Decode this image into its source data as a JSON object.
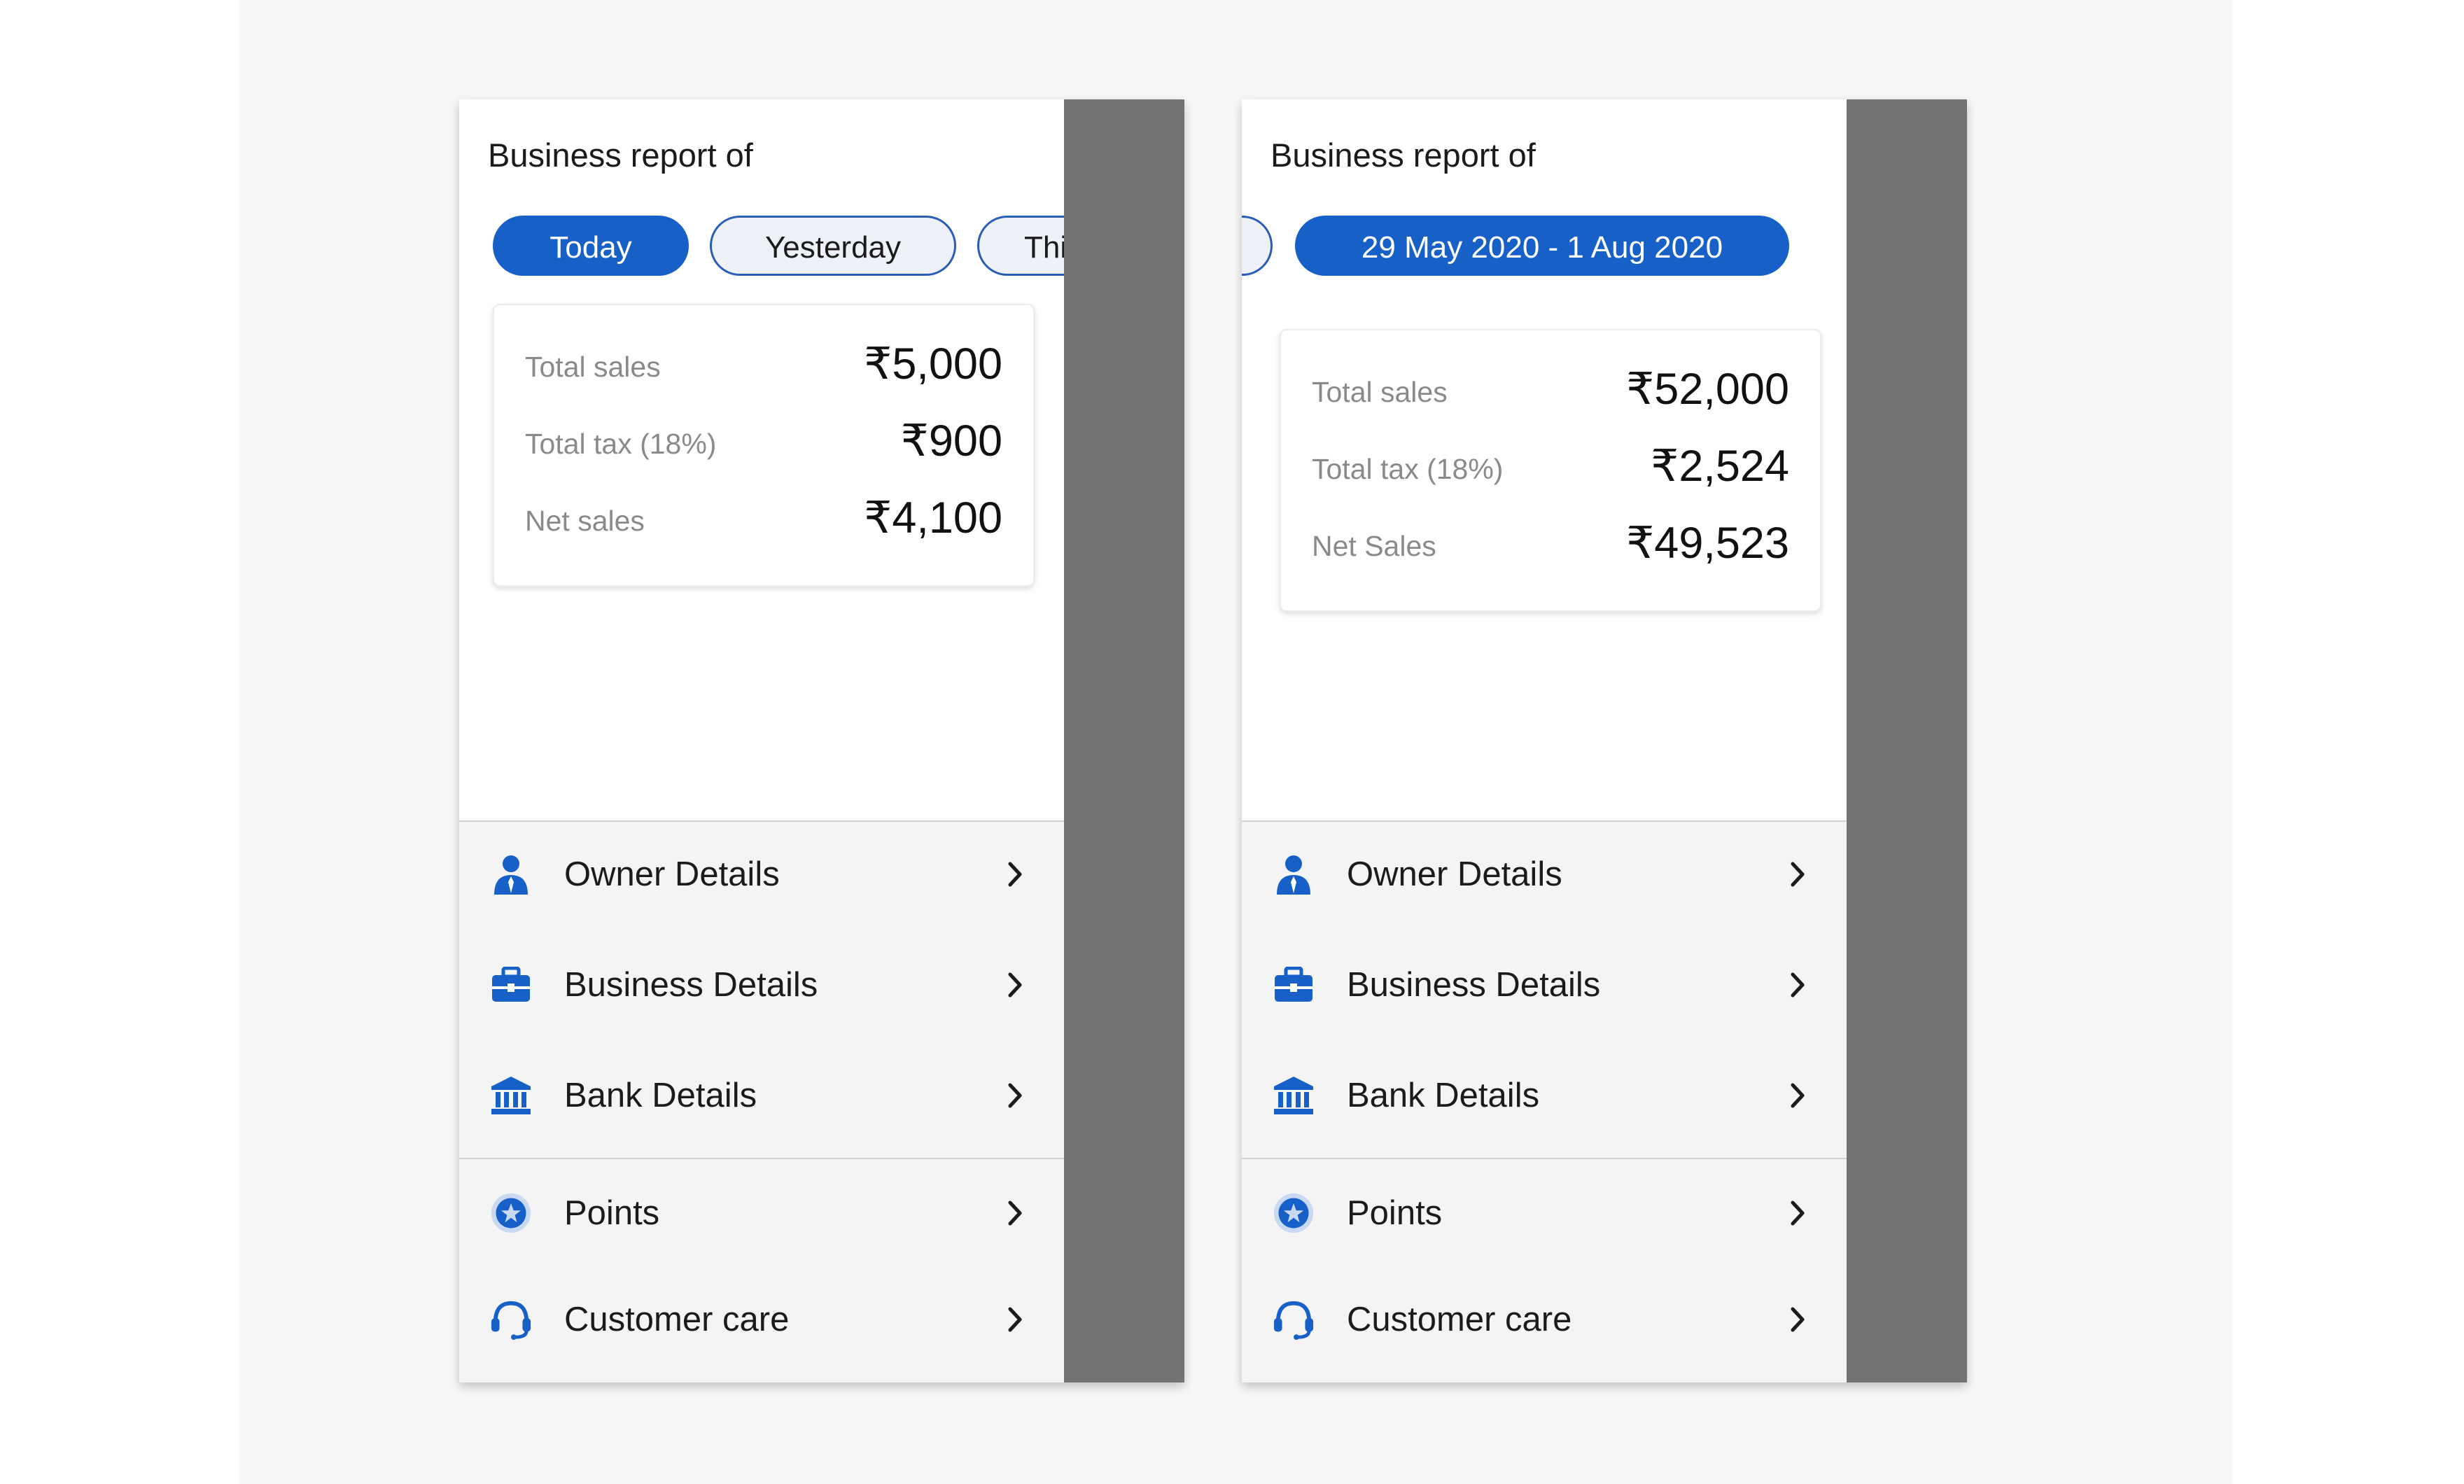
{
  "colors": {
    "accent": "#1760c8",
    "overlay": "#737373",
    "background": "#f7f7f7"
  },
  "screens": [
    {
      "report_title": "Business report of",
      "chips": [
        {
          "label": "Today",
          "active": true
        },
        {
          "label": "Yesterday",
          "active": false
        },
        {
          "label": "Thi",
          "active": false
        }
      ],
      "summary": {
        "rows": [
          {
            "label": "Total sales",
            "value": "₹5,000"
          },
          {
            "label": "Total tax (18%)",
            "value": "₹900"
          },
          {
            "label": "Net sales",
            "value": "₹4,100"
          }
        ]
      }
    },
    {
      "report_title": "Business report of",
      "chips": [
        {
          "label": "",
          "active": false
        },
        {
          "label": "29 May 2020 - 1 Aug 2020",
          "active": true
        }
      ],
      "summary": {
        "rows": [
          {
            "label": "Total sales",
            "value": "₹52,000"
          },
          {
            "label": "Total tax (18%)",
            "value": "₹2,524"
          },
          {
            "label": "Net Sales",
            "value": "₹49,523"
          }
        ]
      }
    }
  ],
  "menu": {
    "items": [
      {
        "label": "Owner Details",
        "icon": "person-icon"
      },
      {
        "label": "Business Details",
        "icon": "briefcase-icon"
      },
      {
        "label": "Bank Details",
        "icon": "bank-icon"
      },
      {
        "label": "Points",
        "icon": "star-badge-icon"
      },
      {
        "label": "Customer care",
        "icon": "headset-icon"
      }
    ]
  }
}
